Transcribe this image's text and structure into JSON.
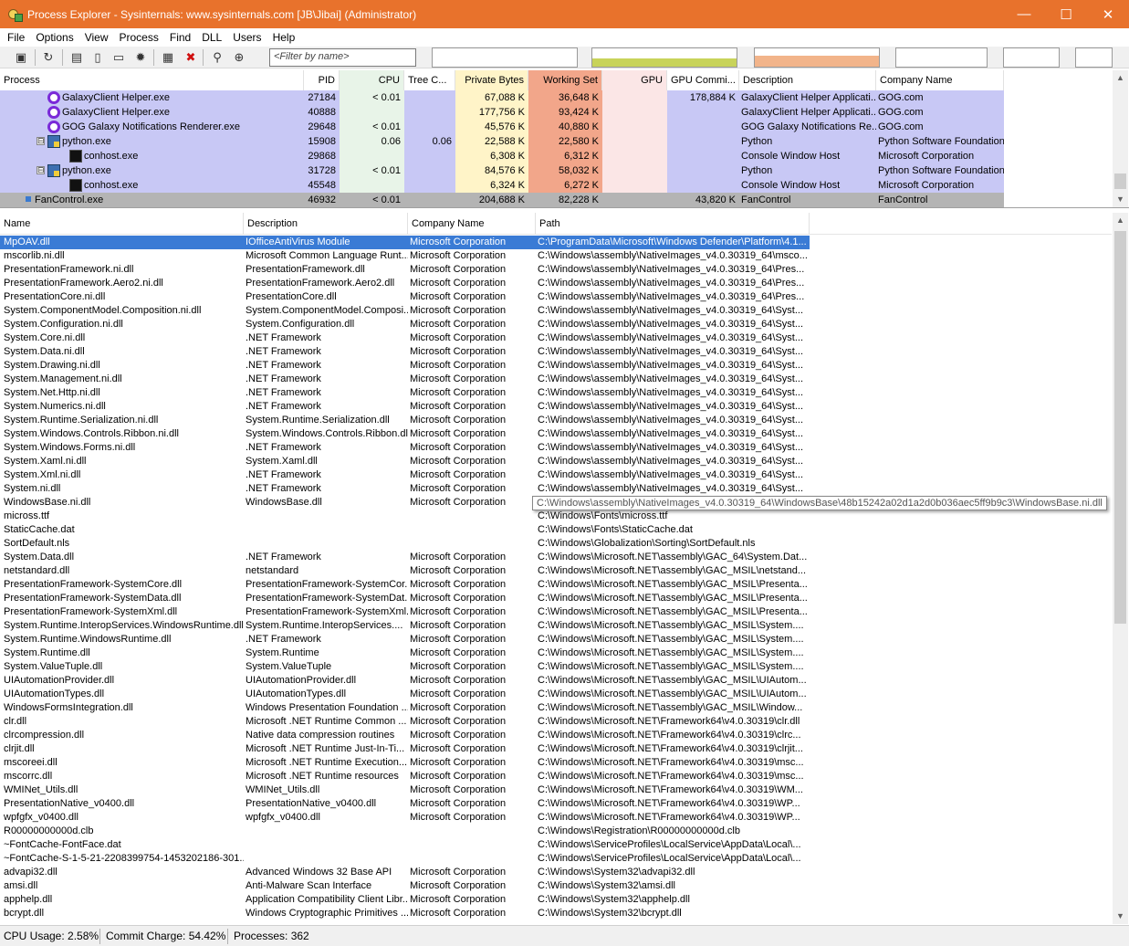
{
  "window": {
    "title": "Process Explorer - Sysinternals: www.sysinternals.com [JB\\Jibai] (Administrator)",
    "minimize": "—",
    "maximize": "☐",
    "close": "✕"
  },
  "menu": [
    "File",
    "Options",
    "View",
    "Process",
    "Find",
    "DLL",
    "Users",
    "Help"
  ],
  "toolbar": {
    "filter_placeholder": "<Filter by name>",
    "colors": {
      "cpu_graph": "#c8d35a",
      "commit_graph": "#f2b48a"
    }
  },
  "process_pane": {
    "columns": [
      "Process",
      "PID",
      "CPU",
      "Tree C...",
      "Private Bytes",
      "Working Set",
      "GPU",
      "GPU Commi...",
      "Description",
      "Company Name"
    ],
    "column_colors": {
      "cpu": "#e8f4e8",
      "private_bytes": "#fff4c8",
      "working_set": "#f2a68a",
      "gpu": "#fbe6e6",
      "row_highlight": "#c8c8f5",
      "selected_row": "#b4b4b4"
    },
    "rows": [
      {
        "name": "GalaxyClient Helper.exe",
        "pid": "27184",
        "cpu": "< 0.01",
        "tree_cpu": "",
        "private_bytes": "67,088 K",
        "working_set": "36,648 K",
        "gpu": "",
        "gpu_commit": "178,884 K",
        "description": "GalaxyClient Helper Applicati...",
        "company": "GOG.com",
        "icon": "gog-icon",
        "indent": 1,
        "expander": ""
      },
      {
        "name": "GalaxyClient Helper.exe",
        "pid": "40888",
        "cpu": "",
        "tree_cpu": "",
        "private_bytes": "177,756 K",
        "working_set": "93,424 K",
        "gpu": "",
        "gpu_commit": "",
        "description": "GalaxyClient Helper Applicati...",
        "company": "GOG.com",
        "icon": "gog-icon",
        "indent": 1,
        "expander": ""
      },
      {
        "name": "GOG Galaxy Notifications Renderer.exe",
        "pid": "29648",
        "cpu": "< 0.01",
        "tree_cpu": "",
        "private_bytes": "45,576 K",
        "working_set": "40,880 K",
        "gpu": "",
        "gpu_commit": "",
        "description": "GOG Galaxy Notifications Re...",
        "company": "GOG.com",
        "icon": "gog-icon",
        "indent": 1,
        "expander": ""
      },
      {
        "name": "python.exe",
        "pid": "15908",
        "cpu": "0.06",
        "tree_cpu": "0.06",
        "private_bytes": "22,588 K",
        "working_set": "22,580 K",
        "gpu": "",
        "gpu_commit": "",
        "description": "Python",
        "company": "Python Software Foundation",
        "icon": "python-icon",
        "indent": 1,
        "expander": "⊟"
      },
      {
        "name": "conhost.exe",
        "pid": "29868",
        "cpu": "",
        "tree_cpu": "",
        "private_bytes": "6,308 K",
        "working_set": "6,312 K",
        "gpu": "",
        "gpu_commit": "",
        "description": "Console Window Host",
        "company": "Microsoft Corporation",
        "icon": "console-icon",
        "indent": 2,
        "expander": ""
      },
      {
        "name": "python.exe",
        "pid": "31728",
        "cpu": "< 0.01",
        "tree_cpu": "",
        "private_bytes": "84,576 K",
        "working_set": "58,032 K",
        "gpu": "",
        "gpu_commit": "",
        "description": "Python",
        "company": "Python Software Foundation",
        "icon": "python-icon",
        "indent": 1,
        "expander": "⊟"
      },
      {
        "name": "conhost.exe",
        "pid": "45548",
        "cpu": "",
        "tree_cpu": "",
        "private_bytes": "6,324 K",
        "working_set": "6,272 K",
        "gpu": "",
        "gpu_commit": "",
        "description": "Console Window Host",
        "company": "Microsoft Corporation",
        "icon": "console-icon",
        "indent": 2,
        "expander": ""
      },
      {
        "name": "FanControl.exe",
        "pid": "46932",
        "cpu": "< 0.01",
        "tree_cpu": "",
        "private_bytes": "204,688 K",
        "working_set": "82,228 K",
        "gpu": "",
        "gpu_commit": "43,820 K",
        "description": "FanControl",
        "company": "FanControl",
        "icon": "fan-icon",
        "indent": 0,
        "expander": "",
        "selected": true
      }
    ]
  },
  "dll_pane": {
    "columns": [
      "Name",
      "Description",
      "Company Name",
      "Path"
    ],
    "tooltip": "C:\\Windows\\assembly\\NativeImages_v4.0.30319_64\\WindowsBase\\48b15242a02d1a2d0b036aec5ff9b9c3\\WindowsBase.ni.dll",
    "rows": [
      {
        "name": "MpOAV.dll",
        "description": "IOfficeAntiVirus Module",
        "company": "Microsoft Corporation",
        "path": "C:\\ProgramData\\Microsoft\\Windows Defender\\Platform\\4.1...",
        "selected": true
      },
      {
        "name": "mscorlib.ni.dll",
        "description": "Microsoft Common Language Runt...",
        "company": "Microsoft Corporation",
        "path": "C:\\Windows\\assembly\\NativeImages_v4.0.30319_64\\msco..."
      },
      {
        "name": "PresentationFramework.ni.dll",
        "description": "PresentationFramework.dll",
        "company": "Microsoft Corporation",
        "path": "C:\\Windows\\assembly\\NativeImages_v4.0.30319_64\\Pres..."
      },
      {
        "name": "PresentationFramework.Aero2.ni.dll",
        "description": "PresentationFramework.Aero2.dll",
        "company": "Microsoft Corporation",
        "path": "C:\\Windows\\assembly\\NativeImages_v4.0.30319_64\\Pres..."
      },
      {
        "name": "PresentationCore.ni.dll",
        "description": "PresentationCore.dll",
        "company": "Microsoft Corporation",
        "path": "C:\\Windows\\assembly\\NativeImages_v4.0.30319_64\\Pres..."
      },
      {
        "name": "System.ComponentModel.Composition.ni.dll",
        "description": "System.ComponentModel.Composi...",
        "company": "Microsoft Corporation",
        "path": "C:\\Windows\\assembly\\NativeImages_v4.0.30319_64\\Syst..."
      },
      {
        "name": "System.Configuration.ni.dll",
        "description": "System.Configuration.dll",
        "company": "Microsoft Corporation",
        "path": "C:\\Windows\\assembly\\NativeImages_v4.0.30319_64\\Syst..."
      },
      {
        "name": "System.Core.ni.dll",
        "description": ".NET Framework",
        "company": "Microsoft Corporation",
        "path": "C:\\Windows\\assembly\\NativeImages_v4.0.30319_64\\Syst..."
      },
      {
        "name": "System.Data.ni.dll",
        "description": ".NET Framework",
        "company": "Microsoft Corporation",
        "path": "C:\\Windows\\assembly\\NativeImages_v4.0.30319_64\\Syst..."
      },
      {
        "name": "System.Drawing.ni.dll",
        "description": ".NET Framework",
        "company": "Microsoft Corporation",
        "path": "C:\\Windows\\assembly\\NativeImages_v4.0.30319_64\\Syst..."
      },
      {
        "name": "System.Management.ni.dll",
        "description": ".NET Framework",
        "company": "Microsoft Corporation",
        "path": "C:\\Windows\\assembly\\NativeImages_v4.0.30319_64\\Syst..."
      },
      {
        "name": "System.Net.Http.ni.dll",
        "description": ".NET Framework",
        "company": "Microsoft Corporation",
        "path": "C:\\Windows\\assembly\\NativeImages_v4.0.30319_64\\Syst..."
      },
      {
        "name": "System.Numerics.ni.dll",
        "description": ".NET Framework",
        "company": "Microsoft Corporation",
        "path": "C:\\Windows\\assembly\\NativeImages_v4.0.30319_64\\Syst..."
      },
      {
        "name": "System.Runtime.Serialization.ni.dll",
        "description": "System.Runtime.Serialization.dll",
        "company": "Microsoft Corporation",
        "path": "C:\\Windows\\assembly\\NativeImages_v4.0.30319_64\\Syst..."
      },
      {
        "name": "System.Windows.Controls.Ribbon.ni.dll",
        "description": "System.Windows.Controls.Ribbon.dll",
        "company": "Microsoft Corporation",
        "path": "C:\\Windows\\assembly\\NativeImages_v4.0.30319_64\\Syst..."
      },
      {
        "name": "System.Windows.Forms.ni.dll",
        "description": ".NET Framework",
        "company": "Microsoft Corporation",
        "path": "C:\\Windows\\assembly\\NativeImages_v4.0.30319_64\\Syst..."
      },
      {
        "name": "System.Xaml.ni.dll",
        "description": "System.Xaml.dll",
        "company": "Microsoft Corporation",
        "path": "C:\\Windows\\assembly\\NativeImages_v4.0.30319_64\\Syst..."
      },
      {
        "name": "System.Xml.ni.dll",
        "description": ".NET Framework",
        "company": "Microsoft Corporation",
        "path": "C:\\Windows\\assembly\\NativeImages_v4.0.30319_64\\Syst..."
      },
      {
        "name": "System.ni.dll",
        "description": ".NET Framework",
        "company": "Microsoft Corporation",
        "path": "C:\\Windows\\assembly\\NativeImages_v4.0.30319_64\\Syst..."
      },
      {
        "name": "WindowsBase.ni.dll",
        "description": "WindowsBase.dll",
        "company": "Microsoft Corporation",
        "path": ""
      },
      {
        "name": "micross.ttf",
        "description": "",
        "company": "",
        "path": "C:\\Windows\\Fonts\\micross.ttf"
      },
      {
        "name": "StaticCache.dat",
        "description": "",
        "company": "",
        "path": "C:\\Windows\\Fonts\\StaticCache.dat"
      },
      {
        "name": "SortDefault.nls",
        "description": "",
        "company": "",
        "path": "C:\\Windows\\Globalization\\Sorting\\SortDefault.nls"
      },
      {
        "name": "System.Data.dll",
        "description": ".NET Framework",
        "company": "Microsoft Corporation",
        "path": "C:\\Windows\\Microsoft.NET\\assembly\\GAC_64\\System.Dat..."
      },
      {
        "name": "netstandard.dll",
        "description": "netstandard",
        "company": "Microsoft Corporation",
        "path": "C:\\Windows\\Microsoft.NET\\assembly\\GAC_MSIL\\netstand..."
      },
      {
        "name": "PresentationFramework-SystemCore.dll",
        "description": "PresentationFramework-SystemCor...",
        "company": "Microsoft Corporation",
        "path": "C:\\Windows\\Microsoft.NET\\assembly\\GAC_MSIL\\Presenta..."
      },
      {
        "name": "PresentationFramework-SystemData.dll",
        "description": "PresentationFramework-SystemDat...",
        "company": "Microsoft Corporation",
        "path": "C:\\Windows\\Microsoft.NET\\assembly\\GAC_MSIL\\Presenta..."
      },
      {
        "name": "PresentationFramework-SystemXml.dll",
        "description": "PresentationFramework-SystemXml...",
        "company": "Microsoft Corporation",
        "path": "C:\\Windows\\Microsoft.NET\\assembly\\GAC_MSIL\\Presenta..."
      },
      {
        "name": "System.Runtime.InteropServices.WindowsRuntime.dll",
        "description": "System.Runtime.InteropServices....",
        "company": "Microsoft Corporation",
        "path": "C:\\Windows\\Microsoft.NET\\assembly\\GAC_MSIL\\System...."
      },
      {
        "name": "System.Runtime.WindowsRuntime.dll",
        "description": ".NET Framework",
        "company": "Microsoft Corporation",
        "path": "C:\\Windows\\Microsoft.NET\\assembly\\GAC_MSIL\\System...."
      },
      {
        "name": "System.Runtime.dll",
        "description": "System.Runtime",
        "company": "Microsoft Corporation",
        "path": "C:\\Windows\\Microsoft.NET\\assembly\\GAC_MSIL\\System...."
      },
      {
        "name": "System.ValueTuple.dll",
        "description": "System.ValueTuple",
        "company": "Microsoft Corporation",
        "path": "C:\\Windows\\Microsoft.NET\\assembly\\GAC_MSIL\\System...."
      },
      {
        "name": "UIAutomationProvider.dll",
        "description": "UIAutomationProvider.dll",
        "company": "Microsoft Corporation",
        "path": "C:\\Windows\\Microsoft.NET\\assembly\\GAC_MSIL\\UIAutom..."
      },
      {
        "name": "UIAutomationTypes.dll",
        "description": "UIAutomationTypes.dll",
        "company": "Microsoft Corporation",
        "path": "C:\\Windows\\Microsoft.NET\\assembly\\GAC_MSIL\\UIAutom..."
      },
      {
        "name": "WindowsFormsIntegration.dll",
        "description": "Windows Presentation Foundation ...",
        "company": "Microsoft Corporation",
        "path": "C:\\Windows\\Microsoft.NET\\assembly\\GAC_MSIL\\Window..."
      },
      {
        "name": "clr.dll",
        "description": "Microsoft .NET Runtime Common ...",
        "company": "Microsoft Corporation",
        "path": "C:\\Windows\\Microsoft.NET\\Framework64\\v4.0.30319\\clr.dll"
      },
      {
        "name": "clrcompression.dll",
        "description": "Native data compression routines",
        "company": "Microsoft Corporation",
        "path": "C:\\Windows\\Microsoft.NET\\Framework64\\v4.0.30319\\clrc..."
      },
      {
        "name": "clrjit.dll",
        "description": "Microsoft .NET Runtime Just-In-Ti...",
        "company": "Microsoft Corporation",
        "path": "C:\\Windows\\Microsoft.NET\\Framework64\\v4.0.30319\\clrjit..."
      },
      {
        "name": "mscoreei.dll",
        "description": "Microsoft .NET Runtime Execution...",
        "company": "Microsoft Corporation",
        "path": "C:\\Windows\\Microsoft.NET\\Framework64\\v4.0.30319\\msc..."
      },
      {
        "name": "mscorrc.dll",
        "description": "Microsoft .NET Runtime resources",
        "company": "Microsoft Corporation",
        "path": "C:\\Windows\\Microsoft.NET\\Framework64\\v4.0.30319\\msc..."
      },
      {
        "name": "WMINet_Utils.dll",
        "description": "WMINet_Utils.dll",
        "company": "Microsoft Corporation",
        "path": "C:\\Windows\\Microsoft.NET\\Framework64\\v4.0.30319\\WM..."
      },
      {
        "name": "PresentationNative_v0400.dll",
        "description": "PresentationNative_v0400.dll",
        "company": "Microsoft Corporation",
        "path": "C:\\Windows\\Microsoft.NET\\Framework64\\v4.0.30319\\WP..."
      },
      {
        "name": "wpfgfx_v0400.dll",
        "description": "wpfgfx_v0400.dll",
        "company": "Microsoft Corporation",
        "path": "C:\\Windows\\Microsoft.NET\\Framework64\\v4.0.30319\\WP..."
      },
      {
        "name": "R00000000000d.clb",
        "description": "",
        "company": "",
        "path": "C:\\Windows\\Registration\\R00000000000d.clb"
      },
      {
        "name": "~FontCache-FontFace.dat",
        "description": "",
        "company": "",
        "path": "C:\\Windows\\ServiceProfiles\\LocalService\\AppData\\Local\\..."
      },
      {
        "name": "~FontCache-S-1-5-21-2208399754-1453202186-301...",
        "description": "",
        "company": "",
        "path": "C:\\Windows\\ServiceProfiles\\LocalService\\AppData\\Local\\..."
      },
      {
        "name": "advapi32.dll",
        "description": "Advanced Windows 32 Base API",
        "company": "Microsoft Corporation",
        "path": "C:\\Windows\\System32\\advapi32.dll"
      },
      {
        "name": "amsi.dll",
        "description": "Anti-Malware Scan Interface",
        "company": "Microsoft Corporation",
        "path": "C:\\Windows\\System32\\amsi.dll"
      },
      {
        "name": "apphelp.dll",
        "description": "Application Compatibility Client Libr...",
        "company": "Microsoft Corporation",
        "path": "C:\\Windows\\System32\\apphelp.dll"
      },
      {
        "name": "bcrypt.dll",
        "description": "Windows Cryptographic Primitives ...",
        "company": "Microsoft Corporation",
        "path": "C:\\Windows\\System32\\bcrypt.dll"
      }
    ]
  },
  "status": {
    "cpu_usage": "CPU Usage: 2.58%",
    "commit_charge": "Commit Charge: 54.42%",
    "processes": "Processes: 362"
  }
}
